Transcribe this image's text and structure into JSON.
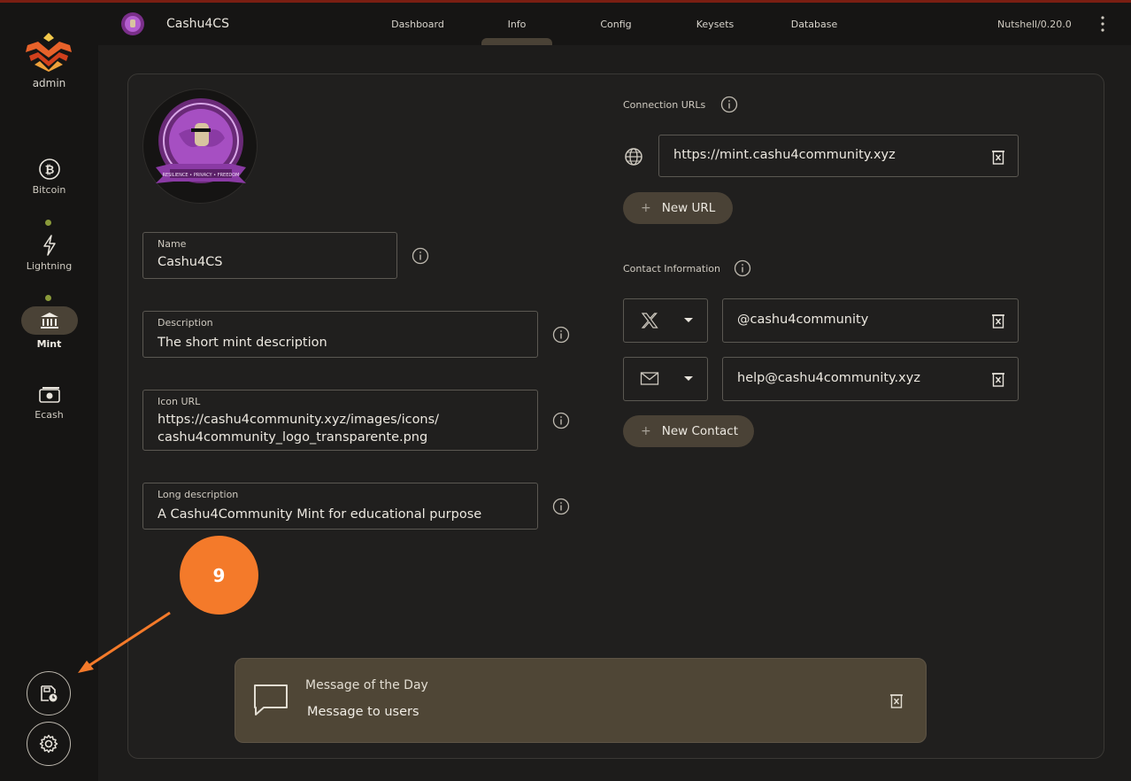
{
  "sidebar": {
    "user": "admin",
    "items": [
      {
        "label": "Bitcoin",
        "icon": "bitcoin-icon"
      },
      {
        "label": "Lightning",
        "icon": "lightning-icon"
      },
      {
        "label": "Mint",
        "icon": "bank-icon",
        "active": true
      },
      {
        "label": "Ecash",
        "icon": "cash-icon"
      }
    ],
    "bottom_buttons": [
      "save-schedule-icon",
      "gear-icon"
    ]
  },
  "header": {
    "app_title": "Cashu4CS",
    "tabs": [
      "Dashboard",
      "Info",
      "Config",
      "Keysets",
      "Database"
    ],
    "active_tab": "Info",
    "version": "Nutshell/0.20.0"
  },
  "form": {
    "name": {
      "label": "Name",
      "value": "Cashu4CS"
    },
    "description": {
      "label": "Description",
      "value": "The short mint description"
    },
    "icon_url": {
      "label": "Icon URL",
      "value_line1": "https://cashu4community.xyz/images/icons/",
      "value_line2": "cashu4community_logo_transparente.png"
    },
    "long_description": {
      "label": "Long description",
      "value": "A Cashu4Community Mint for educational purpose"
    }
  },
  "connection": {
    "label": "Connection URLs",
    "urls": [
      "https://mint.cashu4community.xyz"
    ],
    "add_button": "New URL"
  },
  "contact": {
    "label": "Contact Information",
    "entries": [
      {
        "type": "x-icon",
        "value": "@cashu4community"
      },
      {
        "type": "mail-icon",
        "value": "help@cashu4community.xyz"
      }
    ],
    "add_button": "New Contact"
  },
  "motd": {
    "title": "Message of the Day",
    "message": "Message to users"
  },
  "annotation": {
    "number": "9",
    "color": "#f47a2a"
  },
  "colors": {
    "accent": "#4a4236",
    "status_dot": "#8a9a3a"
  }
}
